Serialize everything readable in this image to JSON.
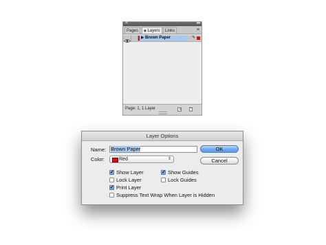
{
  "layers_panel": {
    "tabs": [
      {
        "label": "Pages"
      },
      {
        "label": "Layers"
      },
      {
        "label": "Links"
      }
    ],
    "layers": [
      {
        "name": "Brown Paper",
        "color": "#c8141a",
        "visible": true,
        "locked": false,
        "selected": true
      }
    ],
    "footer_status": "Page: 1, 1 Layer",
    "icons": {
      "close": "close-icon",
      "collapse": "collapse-icon",
      "menu": "panel-menu-icon",
      "visibility": "eye-icon",
      "pen": "pen-icon",
      "new_layer": "new-layer-icon",
      "delete": "trash-icon"
    }
  },
  "dialog": {
    "title": "Layer Options",
    "name_label": "Name:",
    "name_value": "Brown Paper",
    "color_label": "Color:",
    "color_value": "Red",
    "color_swatch": "#c8141a",
    "ok_label": "OK",
    "cancel_label": "Cancel",
    "options": {
      "show_layer": {
        "label": "Show Layer",
        "checked": true
      },
      "show_guides": {
        "label": "Show Guides",
        "checked": true
      },
      "lock_layer": {
        "label": "Lock Layer",
        "checked": false
      },
      "lock_guides": {
        "label": "Lock Guides",
        "checked": false
      },
      "print_layer": {
        "label": "Print Layer",
        "checked": true
      },
      "suppress_text_wrap": {
        "label": "Suppress Text Wrap When Layer is Hidden",
        "checked": false
      }
    }
  },
  "colors": {
    "accent_blue": "#6fa8ee",
    "selection_blue": "#a9c8ee",
    "layer_red": "#c8141a"
  }
}
